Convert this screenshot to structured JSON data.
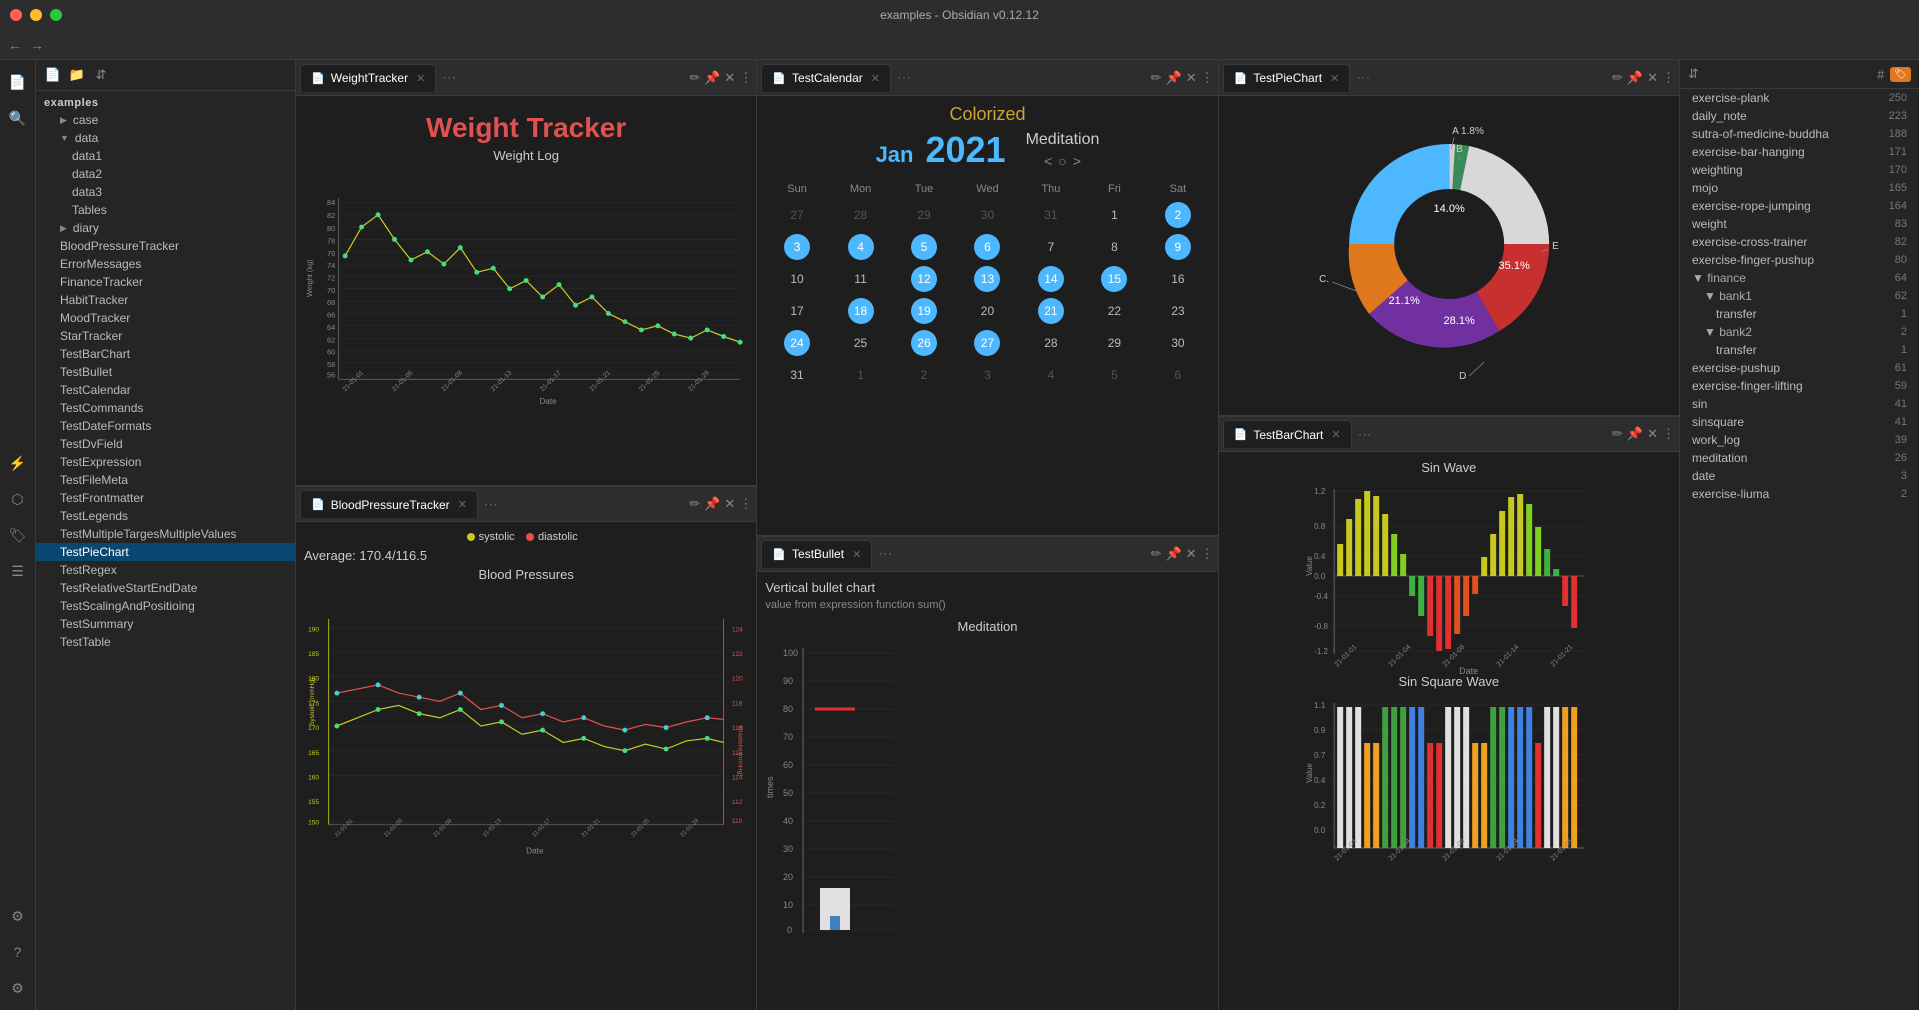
{
  "titlebar": {
    "title": "examples - Obsidian v0.12.12"
  },
  "sidebar": {
    "root": "examples",
    "items": [
      {
        "label": "case",
        "indent": 1,
        "type": "folder",
        "collapsed": true
      },
      {
        "label": "data",
        "indent": 1,
        "type": "folder",
        "collapsed": false
      },
      {
        "label": "data1",
        "indent": 2,
        "type": "file"
      },
      {
        "label": "data2",
        "indent": 2,
        "type": "file"
      },
      {
        "label": "data3",
        "indent": 2,
        "type": "file"
      },
      {
        "label": "Tables",
        "indent": 2,
        "type": "file"
      },
      {
        "label": "diary",
        "indent": 1,
        "type": "folder",
        "collapsed": true
      },
      {
        "label": "BloodPressureTracker",
        "indent": 1,
        "type": "file"
      },
      {
        "label": "ErrorMessages",
        "indent": 1,
        "type": "file"
      },
      {
        "label": "FinanceTracker",
        "indent": 1,
        "type": "file"
      },
      {
        "label": "HabitTracker",
        "indent": 1,
        "type": "file"
      },
      {
        "label": "MoodTracker",
        "indent": 1,
        "type": "file"
      },
      {
        "label": "StarTracker",
        "indent": 1,
        "type": "file"
      },
      {
        "label": "TestBarChart",
        "indent": 1,
        "type": "file"
      },
      {
        "label": "TestBullet",
        "indent": 1,
        "type": "file"
      },
      {
        "label": "TestCalendar",
        "indent": 1,
        "type": "file"
      },
      {
        "label": "TestCommands",
        "indent": 1,
        "type": "file"
      },
      {
        "label": "TestDateFormats",
        "indent": 1,
        "type": "file"
      },
      {
        "label": "TestDvField",
        "indent": 1,
        "type": "file"
      },
      {
        "label": "TestExpression",
        "indent": 1,
        "type": "file"
      },
      {
        "label": "TestFileMeta",
        "indent": 1,
        "type": "file"
      },
      {
        "label": "TestFrontmatter",
        "indent": 1,
        "type": "file"
      },
      {
        "label": "TestLegends",
        "indent": 1,
        "type": "file"
      },
      {
        "label": "TestMultipleTargesMultipleValues",
        "indent": 1,
        "type": "file"
      },
      {
        "label": "TestPieChart",
        "indent": 1,
        "type": "file",
        "active": true
      },
      {
        "label": "TestRegex",
        "indent": 1,
        "type": "file"
      },
      {
        "label": "TestRelativeStartEndDate",
        "indent": 1,
        "type": "file"
      },
      {
        "label": "TestScalingAndPositioing",
        "indent": 1,
        "type": "file"
      },
      {
        "label": "TestSummary",
        "indent": 1,
        "type": "file"
      },
      {
        "label": "TestTable",
        "indent": 1,
        "type": "file"
      }
    ]
  },
  "tabs": {
    "col1": [
      {
        "label": "WeightTracker",
        "active": true
      },
      {
        "label": "BloodPressureTracker",
        "active": false
      }
    ],
    "col2": [
      {
        "label": "TestCalendar",
        "active": true
      },
      {
        "label": "TestBullet",
        "active": false
      }
    ],
    "col3": [
      {
        "label": "TestPieChart",
        "active": true
      },
      {
        "label": "TestBarChart",
        "active": false
      }
    ]
  },
  "weight_tracker": {
    "title": "Weight Tracker",
    "chart_title": "Weight Log",
    "x_label": "Date",
    "y_label": "Weight (kg)"
  },
  "calendar": {
    "colorized_label": "Colorized",
    "title": "Meditation",
    "month": "Jan",
    "year": "2021",
    "days_header": [
      "Sun",
      "Mon",
      "Tue",
      "Wed",
      "Thu",
      "Fri",
      "Sat"
    ],
    "weeks": [
      [
        {
          "day": "27",
          "other": true
        },
        {
          "day": "28",
          "other": true
        },
        {
          "day": "29",
          "other": true
        },
        {
          "day": "30",
          "other": true
        },
        {
          "day": "31",
          "other": true
        },
        {
          "day": "1"
        },
        {
          "day": "2",
          "highlighted": true
        }
      ],
      [
        {
          "day": "3",
          "highlighted": true
        },
        {
          "day": "4",
          "highlighted": true
        },
        {
          "day": "5",
          "highlighted": true
        },
        {
          "day": "6",
          "highlighted": true
        },
        {
          "day": "7"
        },
        {
          "day": "8"
        },
        {
          "day": "9",
          "highlighted": true
        }
      ],
      [
        {
          "day": "10"
        },
        {
          "day": "11"
        },
        {
          "day": "12",
          "highlighted": true
        },
        {
          "day": "13",
          "highlighted": true
        },
        {
          "day": "14",
          "highlighted": true
        },
        {
          "day": "15",
          "highlighted": true
        },
        {
          "day": "16"
        }
      ],
      [
        {
          "day": "17"
        },
        {
          "day": "18",
          "highlighted": true
        },
        {
          "day": "19",
          "highlighted": true
        },
        {
          "day": "20"
        },
        {
          "day": "21",
          "highlighted": true
        },
        {
          "day": "22"
        },
        {
          "day": "23"
        }
      ],
      [
        {
          "day": "24",
          "highlighted": true
        },
        {
          "day": "25"
        },
        {
          "day": "26",
          "highlighted": true
        },
        {
          "day": "27",
          "highlighted": true
        },
        {
          "day": "28"
        },
        {
          "day": "29"
        },
        {
          "day": "30"
        }
      ],
      [
        {
          "day": "31"
        },
        {
          "day": "1",
          "other": true
        },
        {
          "day": "2",
          "other": true
        },
        {
          "day": "3",
          "other": true
        },
        {
          "day": "4",
          "other": true
        },
        {
          "day": "5",
          "other": true
        },
        {
          "day": "6",
          "other": true
        }
      ]
    ]
  },
  "pie_chart": {
    "title": "TestPieChart",
    "slices": [
      {
        "label": "A",
        "percent": "1.8%",
        "color": "#e8e8e8"
      },
      {
        "label": "B",
        "percent": "",
        "color": "#3a8a5a"
      },
      {
        "label": "C.",
        "percent": "21.1%",
        "color": "#e07820"
      },
      {
        "label": "D",
        "percent": "",
        "color": "#c8a0d0"
      },
      {
        "label": "E",
        "percent": "",
        "color": "#e8e8e8"
      },
      {
        "label": "14.0%",
        "color": "#4db8ff"
      },
      {
        "label": "35.1%",
        "color": "#e03030"
      },
      {
        "label": "28.1%",
        "color": "#8040c0"
      }
    ]
  },
  "blood_pressure": {
    "title": "BloodPressureTracker",
    "average": "Average: 170.4/116.5",
    "chart_title": "Blood Pressures",
    "legend": [
      {
        "label": "systolic",
        "color": "#c8c820"
      },
      {
        "label": "diastolic",
        "color": "#e05050"
      }
    ],
    "y_left_label": "Systolic (mmHg)",
    "y_right_label": "Diastolic (mmHg)"
  },
  "bar_chart": {
    "title": "TestBarChart",
    "chart1_title": "Sin Wave",
    "chart2_title": "Sin Square Wave",
    "x_label": "Date",
    "y_label": "Value"
  },
  "bullet_chart": {
    "title": "TestBullet",
    "description": "Vertical bullet chart",
    "subtitle": "value from expression function sum()",
    "chart_title": "Meditation",
    "y_label": "times"
  },
  "right_sidebar": {
    "tags": [
      {
        "name": "exercise-plank",
        "count": 250,
        "indent": 0
      },
      {
        "name": "daily_note",
        "count": 223,
        "indent": 0
      },
      {
        "name": "sutra-of-medicine-buddha",
        "count": 188,
        "indent": 0
      },
      {
        "name": "exercise-bar-hanging",
        "count": 171,
        "indent": 0
      },
      {
        "name": "weighting",
        "count": 170,
        "indent": 0
      },
      {
        "name": "mojo",
        "count": 165,
        "indent": 0
      },
      {
        "name": "exercise-rope-jumping",
        "count": 164,
        "indent": 0
      },
      {
        "name": "weight",
        "count": 83,
        "indent": 0
      },
      {
        "name": "exercise-cross-trainer",
        "count": 82,
        "indent": 0
      },
      {
        "name": "exercise-finger-pushup",
        "count": 80,
        "indent": 0
      },
      {
        "name": "finance",
        "count": 64,
        "indent": 0,
        "folder": true
      },
      {
        "name": "bank1",
        "count": 62,
        "indent": 1,
        "folder": true
      },
      {
        "name": "transfer",
        "count": 1,
        "indent": 2
      },
      {
        "name": "bank2",
        "count": 2,
        "indent": 1,
        "folder": true
      },
      {
        "name": "transfer",
        "count": 1,
        "indent": 2
      },
      {
        "name": "exercise-pushup",
        "count": 61,
        "indent": 0
      },
      {
        "name": "exercise-finger-lifting",
        "count": 59,
        "indent": 0
      },
      {
        "name": "sin",
        "count": 41,
        "indent": 0
      },
      {
        "name": "sinsquare",
        "count": 41,
        "indent": 0
      },
      {
        "name": "work_log",
        "count": 39,
        "indent": 0
      },
      {
        "name": "meditation",
        "count": 26,
        "indent": 0
      },
      {
        "name": "date",
        "count": 3,
        "indent": 0
      },
      {
        "name": "exercise-liuma",
        "count": 2,
        "indent": 0
      }
    ]
  }
}
